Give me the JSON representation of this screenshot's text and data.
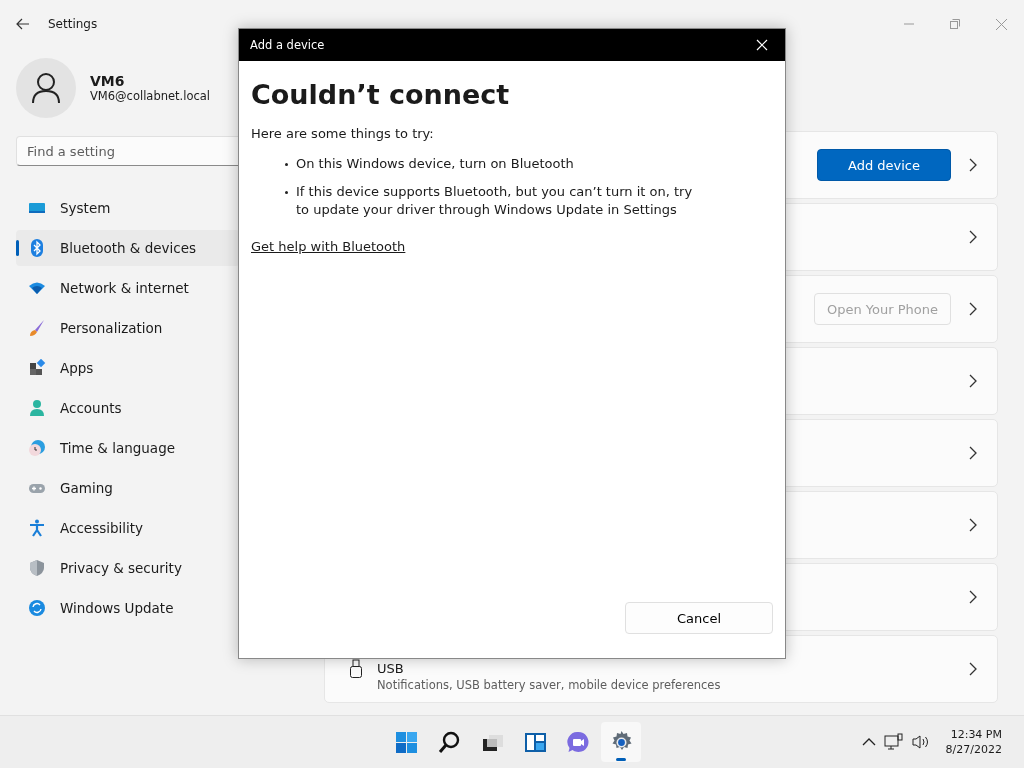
{
  "window": {
    "title": "Settings"
  },
  "account": {
    "name": "VM6",
    "email": "VM6@collabnet.local"
  },
  "search": {
    "placeholder": "Find a setting"
  },
  "sidebar": {
    "items": [
      {
        "label": "System",
        "selected": false
      },
      {
        "label": "Bluetooth & devices",
        "selected": true
      },
      {
        "label": "Network & internet",
        "selected": false
      },
      {
        "label": "Personalization",
        "selected": false
      },
      {
        "label": "Apps",
        "selected": false
      },
      {
        "label": "Accounts",
        "selected": false
      },
      {
        "label": "Time & language",
        "selected": false
      },
      {
        "label": "Gaming",
        "selected": false
      },
      {
        "label": "Accessibility",
        "selected": false
      },
      {
        "label": "Privacy & security",
        "selected": false
      },
      {
        "label": "Windows Update",
        "selected": false
      }
    ]
  },
  "cards": [
    {
      "kind": "action",
      "button": {
        "label": "Add device",
        "kind": "primary",
        "disabled": false
      }
    },
    {
      "kind": "plain"
    },
    {
      "kind": "action",
      "button": {
        "label": "Open Your Phone",
        "kind": "secondary",
        "disabled": true
      }
    },
    {
      "kind": "plain"
    },
    {
      "kind": "plain"
    },
    {
      "kind": "plain"
    },
    {
      "kind": "plain"
    },
    {
      "kind": "detail",
      "title": "USB",
      "subtitle": "Notifications, USB battery saver, mobile device preferences"
    }
  ],
  "dialog": {
    "title": "Add a device",
    "heading": "Couldn’t connect",
    "intro": "Here are some things to try:",
    "tips": [
      "On this Windows device, turn on Bluetooth",
      "If this device supports Bluetooth, but you can’t turn it on, try to update your driver through Windows Update in Settings"
    ],
    "link": "Get help with Bluetooth",
    "cancel": "Cancel"
  },
  "taskbar": {
    "apps": [
      {
        "selected": false
      },
      {
        "selected": false
      },
      {
        "selected": false
      },
      {
        "selected": false
      },
      {
        "selected": false
      },
      {
        "selected": true
      }
    ],
    "time": "12:34 PM",
    "date": "8/27/2022"
  }
}
